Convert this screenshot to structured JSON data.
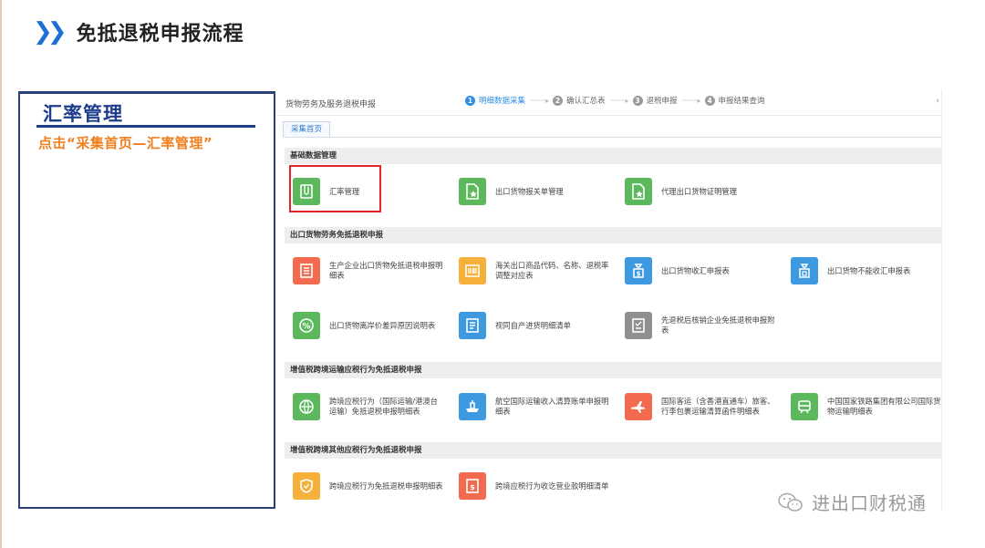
{
  "slide": {
    "title": "免抵退税申报流程",
    "side_heading": "汇率管理",
    "side_instruction": "点击“采集首页—汇率管理”"
  },
  "app": {
    "title": "货物劳务及服务退税申报",
    "steps": [
      {
        "num": "1",
        "label": "明细数据采集",
        "active": true
      },
      {
        "num": "2",
        "label": "确认汇总表",
        "active": false
      },
      {
        "num": "3",
        "label": "退税申报",
        "active": false
      },
      {
        "num": "4",
        "label": "申报结果查询",
        "active": false
      }
    ],
    "step_arrow": "···········▸",
    "more": "›",
    "tab": "采集首页"
  },
  "sections": {
    "s1": "基础数据管理",
    "s2": "出口货物劳务免抵退税申报",
    "s3": "增值税跨境运输应税行为免抵退税申报",
    "s4": "增值税跨境其他应税行为免抵退税申报"
  },
  "tiles": {
    "t1": {
      "label": "汇率管理",
      "icon": "document-clip-icon",
      "color": "#5cb85c"
    },
    "t2": {
      "label": "出口货物报关单管理",
      "icon": "document-star-icon",
      "color": "#5cb85c"
    },
    "t3": {
      "label": "代理出口货物证明管理",
      "icon": "document-star-icon",
      "color": "#5cb85c"
    },
    "t4": {
      "label": "生产企业出口货物免抵退税申报明细表",
      "icon": "document-lines-icon",
      "color": "#f26b4f"
    },
    "t5": {
      "label": "海关出口商品代码、名称、退税率调整对应表",
      "icon": "barcode-icon",
      "color": "#f6b13b"
    },
    "t6": {
      "label": "出口货物收汇申报表",
      "icon": "money-bag-icon",
      "color": "#3d9ae0"
    },
    "t7": {
      "label": "出口货物不能收汇申报表",
      "icon": "money-bag-icon",
      "color": "#3d9ae0"
    },
    "t8": {
      "label": "出口货物离岸价差异原因说明表",
      "icon": "percent-icon",
      "color": "#5cb85c"
    },
    "t9": {
      "label": "视同自产进货明细清单",
      "icon": "list-document-icon",
      "color": "#3d9ae0"
    },
    "t10": {
      "label": "先退税后核销企业免抵退税申报附表",
      "icon": "checklist-icon",
      "color": "#8f8f8f"
    },
    "t11": {
      "label": "跨境应税行为（国际运输/港澳台运输）免抵退税申报明细表",
      "icon": "globe-icon",
      "color": "#5cb85c"
    },
    "t12": {
      "label": "航空国际运输收入清算账单申报明细表",
      "icon": "ship-icon",
      "color": "#3d9ae0"
    },
    "t13": {
      "label": "国际客运（含香港直通车）旅客、行李包裹运输清算函件明细表",
      "icon": "airplane-icon",
      "color": "#f26b4f"
    },
    "t14": {
      "label": "中国国家铁路集团有限公司国际货物运输明细表",
      "icon": "train-icon",
      "color": "#5cb85c"
    },
    "t15": {
      "label": "跨境应税行为免抵退税申报明细表",
      "icon": "shield-document-icon",
      "color": "#f6b13b"
    },
    "t16": {
      "label": "跨境应税行为收讫营业款明细清单",
      "icon": "money-document-icon",
      "color": "#f26b4f"
    }
  },
  "watermark": "进出口财税通"
}
